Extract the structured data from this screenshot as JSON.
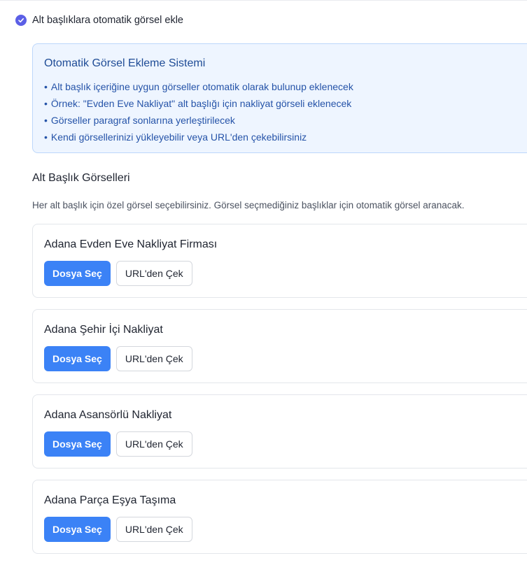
{
  "option": {
    "label": "Alt başlıklara otomatik görsel ekle",
    "checked": true
  },
  "info": {
    "title": "Otomatik Görsel Ekleme Sistemi",
    "bullets": [
      "Alt başlık içeriğine uygun görseller otomatik olarak bulunup eklenecek",
      "Örnek: \"Evden Eve Nakliyat\" alt başlığı için nakliyat görseli eklenecek",
      "Görseller paragraf sonlarına yerleştirilecek",
      "Kendi görsellerinizi yükleyebilir veya URL'den çekebilirsiniz"
    ]
  },
  "section": {
    "title": "Alt Başlık Görselleri",
    "description": "Her alt başlık için özel görsel seçebilirsiniz. Görsel seçmediğiniz başlıklar için otomatik görsel aranacak."
  },
  "cards": [
    {
      "title": "Adana Evden Eve Nakliyat Firması",
      "primary_label": "Dosya Seç",
      "secondary_label": "URL'den Çek"
    },
    {
      "title": "Adana Şehir İçi Nakliyat",
      "primary_label": "Dosya Seç",
      "secondary_label": "URL'den Çek"
    },
    {
      "title": "Adana Asansörlü Nakliyat",
      "primary_label": "Dosya Seç",
      "secondary_label": "URL'den Çek"
    },
    {
      "title": "Adana Parça Eşya Taşıma",
      "primary_label": "Dosya Seç",
      "secondary_label": "URL'den Çek"
    }
  ],
  "colors": {
    "accent": "#3b82f6",
    "checkbox": "#5b5fe6",
    "info_background": "#eef5ff",
    "info_text": "#2553a8"
  }
}
